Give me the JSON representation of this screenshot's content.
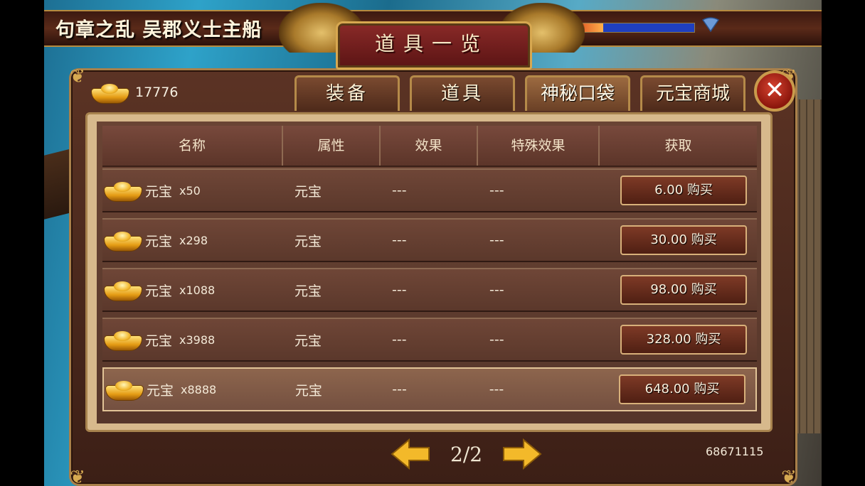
{
  "hud": {
    "location": "句章之乱 吴郡义士主船",
    "hp_fraction": 0.24
  },
  "window": {
    "title": "道具一览",
    "gold_amount": "17776",
    "tabs": [
      {
        "label": "装备",
        "active": false
      },
      {
        "label": "道具",
        "active": false
      },
      {
        "label": "神秘口袋",
        "active": true
      },
      {
        "label": "元宝商城",
        "active": false
      }
    ],
    "close_glyph": "✕"
  },
  "table": {
    "headers": [
      "名称",
      "属性",
      "效果",
      "特殊效果",
      "获取"
    ],
    "rows": [
      {
        "name": "元宝",
        "qty": "x50",
        "attr": "元宝",
        "effect": "---",
        "special": "---",
        "price": "6.00 购买"
      },
      {
        "name": "元宝",
        "qty": "x298",
        "attr": "元宝",
        "effect": "---",
        "special": "---",
        "price": "30.00 购买"
      },
      {
        "name": "元宝",
        "qty": "x1088",
        "attr": "元宝",
        "effect": "---",
        "special": "---",
        "price": "98.00 购买"
      },
      {
        "name": "元宝",
        "qty": "x3988",
        "attr": "元宝",
        "effect": "---",
        "special": "---",
        "price": "328.00 购买"
      },
      {
        "name": "元宝",
        "qty": "x8888",
        "attr": "元宝",
        "effect": "---",
        "special": "---",
        "price": "648.00 购买"
      }
    ]
  },
  "footer": {
    "page": "2/2",
    "player_id": "68671115"
  },
  "icons": {
    "currency": "gold-ingot-icon",
    "prev": "left-arrow-icon",
    "next": "right-arrow-icon",
    "signal": "wifi-icon"
  },
  "colors": {
    "accent_gold": "#d7a850",
    "panel_brown": "#5b3324",
    "buy_red": "#7e3a26"
  }
}
